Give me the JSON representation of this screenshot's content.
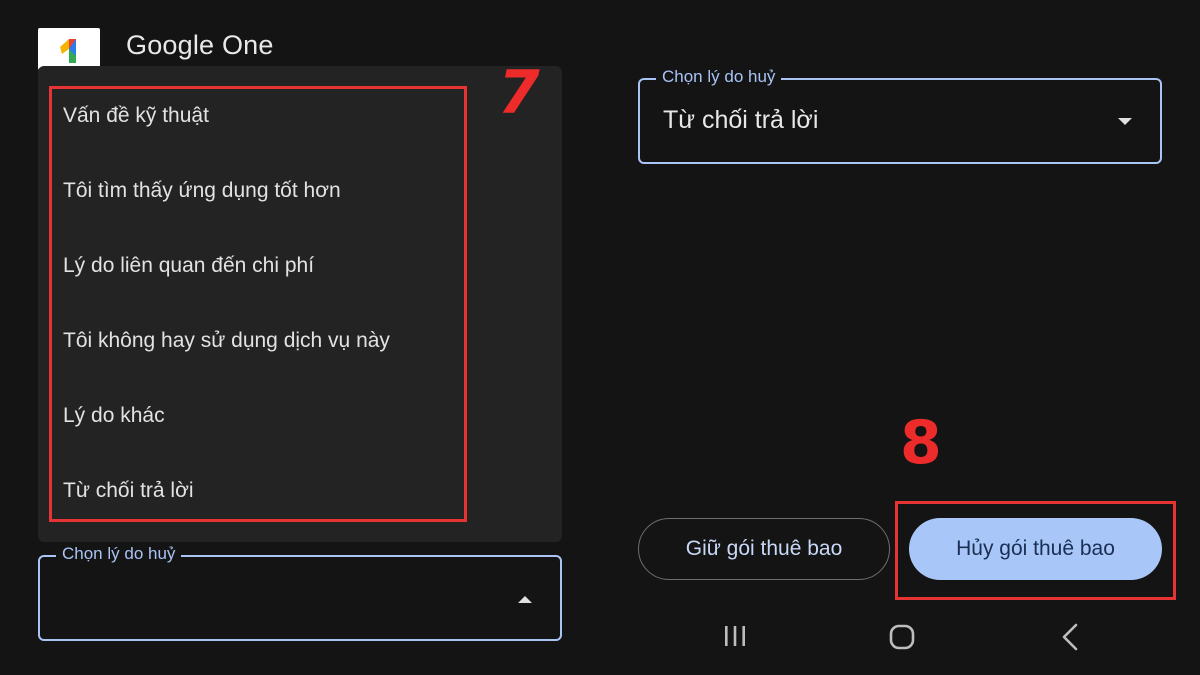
{
  "header": {
    "app_title": "Google One",
    "logo_icon": "google-one-logo"
  },
  "menu": {
    "items": [
      "Vấn đề kỹ thuật",
      "Tôi tìm thấy ứng dụng tốt hơn",
      "Lý do liên quan đến chi phí",
      "Tôi không hay sử dụng dịch vụ này",
      "Lý do khác",
      "Từ chối trả lời"
    ]
  },
  "left_select": {
    "label": "Chọn lý do huỷ",
    "value": "",
    "arrow_icon": "caret-up-icon"
  },
  "right_select": {
    "label": "Chọn lý do huỷ",
    "value": "Từ chối trả lời",
    "arrow_icon": "caret-down-icon"
  },
  "buttons": {
    "keep_label": "Giữ gói thuê bao",
    "cancel_label": "Hủy gói thuê bao"
  },
  "annotations": {
    "step_7": "7",
    "step_8": "8",
    "highlight_color": "#e63333"
  },
  "nav": {
    "icons": [
      "recent-apps-icon",
      "home-icon",
      "back-icon"
    ]
  },
  "colors": {
    "accent": "#a9c6f8",
    "background": "#141414",
    "menu_background": "#232323"
  }
}
